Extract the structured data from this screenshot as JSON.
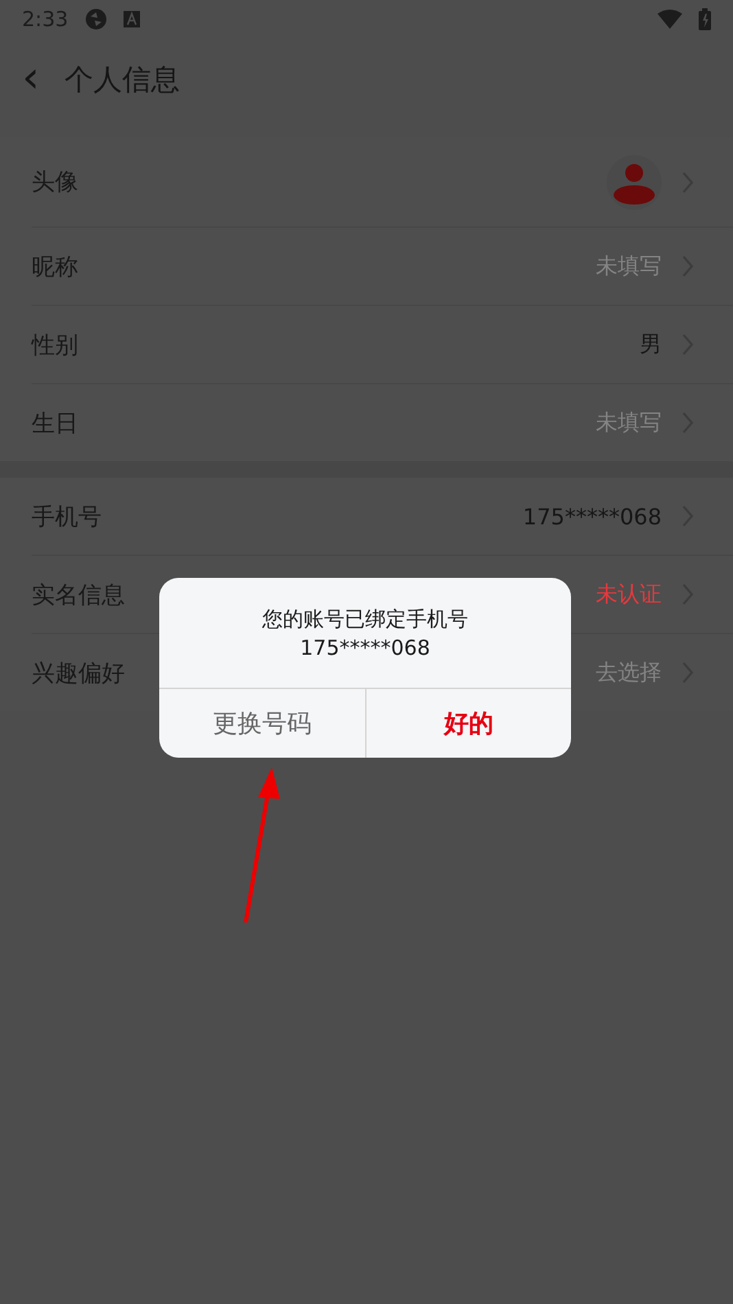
{
  "status_bar": {
    "time": "2:33"
  },
  "header": {
    "back": "‹",
    "title": "个人信息"
  },
  "groups": [
    {
      "rows": [
        {
          "label": "头像",
          "kind": "avatar"
        },
        {
          "label": "昵称",
          "kind": "placeholder",
          "value": "未填写"
        },
        {
          "label": "性别",
          "kind": "plain",
          "value": "男"
        },
        {
          "label": "生日",
          "kind": "placeholder",
          "value": "未填写"
        }
      ]
    },
    {
      "rows": [
        {
          "label": "手机号",
          "kind": "plain",
          "value": "175*****068"
        },
        {
          "label": "实名信息",
          "kind": "warning",
          "value": "未认证"
        },
        {
          "label": "兴趣偏好",
          "kind": "placeholder",
          "value": "去选择"
        }
      ]
    }
  ],
  "dialog": {
    "message": "您的账号已绑定手机号",
    "phone": "175*****068",
    "buttons": [
      {
        "label": "更换号码",
        "kind": "secondary"
      },
      {
        "label": "好的",
        "kind": "primary"
      }
    ]
  }
}
